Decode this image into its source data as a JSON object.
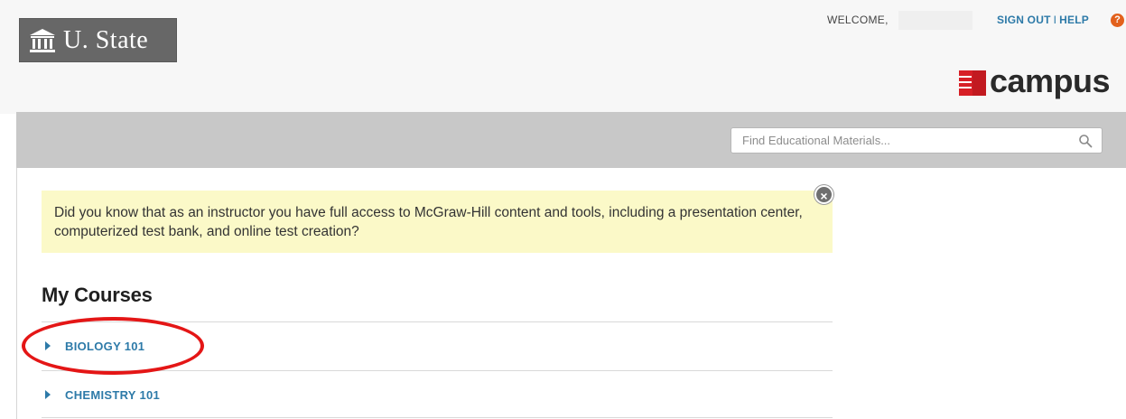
{
  "header": {
    "logo": {
      "text": "U. State",
      "icon": "building-columns-icon"
    },
    "welcome_label": "WELCOME,",
    "account_links": {
      "sign_out": "SIGN OUT",
      "separator": "I",
      "help": "HELP"
    },
    "help_icon": {
      "icon": "question-circle-icon",
      "glyph": "?"
    },
    "brand": {
      "text": "campus",
      "icon": "mcgraw-hill-logo-icon",
      "color": "#d71f26"
    }
  },
  "search": {
    "placeholder": "Find Educational Materials...",
    "icon": "search-icon"
  },
  "notice": {
    "text": "Did you know that as an instructor you have full access to McGraw-Hill content and tools, including a presentation center, computerized test bank, and online test creation?",
    "close_glyph": "×",
    "close_icon": "close-circle-icon"
  },
  "courses": {
    "title": "My Courses",
    "items": [
      {
        "label": "BIOLOGY 101",
        "icon": "triangle-right-icon",
        "highlighted": true
      },
      {
        "label": "CHEMISTRY 101",
        "icon": "triangle-right-icon",
        "highlighted": false
      }
    ]
  },
  "colors": {
    "link": "#2d7aa8",
    "accent": "#e2611c",
    "notice_bg": "#fbf9c8",
    "highlight": "#e41616",
    "band": "#c8c8c8"
  }
}
